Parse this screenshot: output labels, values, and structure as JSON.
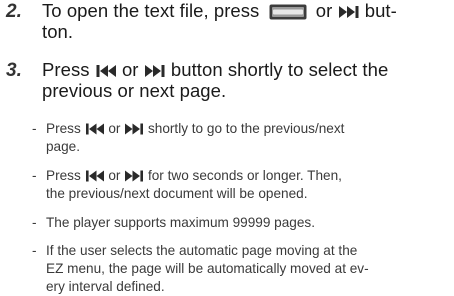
{
  "steps": [
    {
      "number": "2.",
      "parts": [
        "To open the text file, press",
        "or",
        "but-",
        "ton."
      ]
    },
    {
      "number": "3.",
      "parts": [
        "Press",
        "or",
        "button shortly to select the",
        "previous or next page."
      ]
    }
  ],
  "bullets": [
    {
      "dash": "-",
      "parts": [
        "Press",
        "or",
        "shortly to go to the previous/next",
        "page."
      ]
    },
    {
      "dash": "-",
      "parts": [
        "Press",
        "or",
        "for two seconds or longer. Then,",
        "the previous/next document will be opened."
      ]
    },
    {
      "dash": "-",
      "line": "The player supports maximum 99999 pages."
    },
    {
      "dash": "-",
      "lines": [
        "If the user selects the automatic page moving at the",
        "EZ menu, the page will be automatically moved at ev-",
        "ery interval defined."
      ]
    }
  ],
  "icons": {
    "menu_button": "menu-button-icon",
    "prev": "skip-previous-icon",
    "next": "skip-next-icon"
  },
  "colors": {
    "text": "#1a1a1a",
    "icon": "#2a2a2a"
  }
}
